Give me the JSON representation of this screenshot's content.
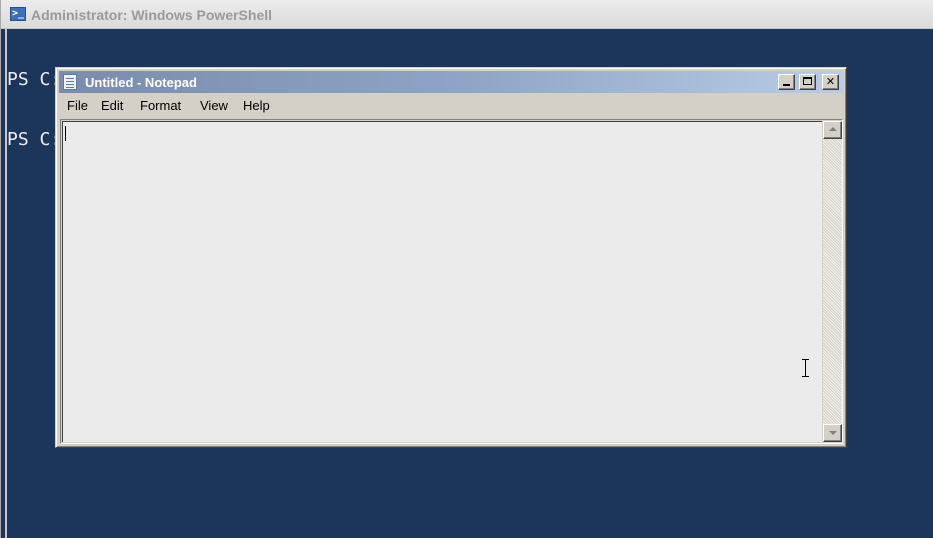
{
  "powershell": {
    "title": "Administrator: Windows PowerShell",
    "icon": "powershell-icon",
    "icon_glyph": ">_",
    "lines": [
      "PS C:\\> notepad",
      "PS C:\\>"
    ],
    "colors": {
      "background": "#1b355b",
      "text": "#eeedf0"
    }
  },
  "notepad": {
    "title": "Untitled - Notepad",
    "icon": "notepad-icon",
    "controls": {
      "minimize": "minimize-icon",
      "maximize": "maximize-icon",
      "close": "close-icon",
      "close_glyph": "✕"
    },
    "menu": [
      "File",
      "Edit",
      "Format",
      "View",
      "Help"
    ],
    "content": "",
    "colors": {
      "titlebar_start": "#7a8cad",
      "titlebar_end": "#b9cce6",
      "text_area": "#ebebeb"
    }
  }
}
